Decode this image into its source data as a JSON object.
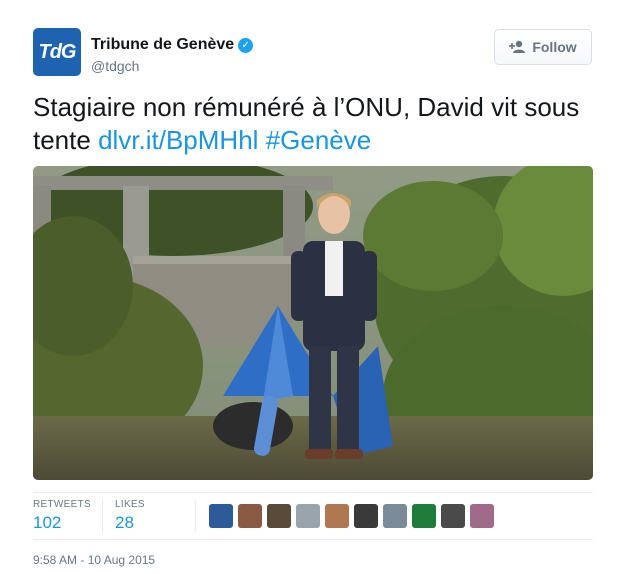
{
  "account": {
    "avatar_text": "TdG",
    "name": "Tribune de Genève",
    "handle": "@tdgch",
    "verified": true,
    "brand_color": "#1d63b0"
  },
  "follow_button": {
    "label": "Follow",
    "icon": "add-user-icon"
  },
  "tweet": {
    "text": "Stagiaire non rémunéré à l’ONU, David vit sous tente",
    "link": "dlvr.it/BpMHhl",
    "hashtag": "#Genève",
    "link_color": "#1b95e0"
  },
  "stats": {
    "retweets_label": "RETWEETS",
    "retweets": "102",
    "likes_label": "LIKES",
    "likes": "28"
  },
  "likers": [
    {
      "icon": "liker-avatar",
      "color": "#2d5b9a"
    },
    {
      "icon": "liker-avatar",
      "color": "#8a5a44"
    },
    {
      "icon": "liker-avatar",
      "color": "#5a4a3a"
    },
    {
      "icon": "liker-avatar",
      "color": "#9aa4ad"
    },
    {
      "icon": "liker-avatar",
      "color": "#b07850"
    },
    {
      "icon": "liker-avatar",
      "color": "#3a3a3a"
    },
    {
      "icon": "liker-avatar",
      "color": "#7b8a99"
    },
    {
      "icon": "liker-avatar",
      "color": "#1e7d3a"
    },
    {
      "icon": "liker-avatar",
      "color": "#4a4a4a"
    },
    {
      "icon": "liker-avatar",
      "color": "#a06a8a"
    }
  ],
  "timestamp": "9:58 AM - 10 Aug 2015"
}
